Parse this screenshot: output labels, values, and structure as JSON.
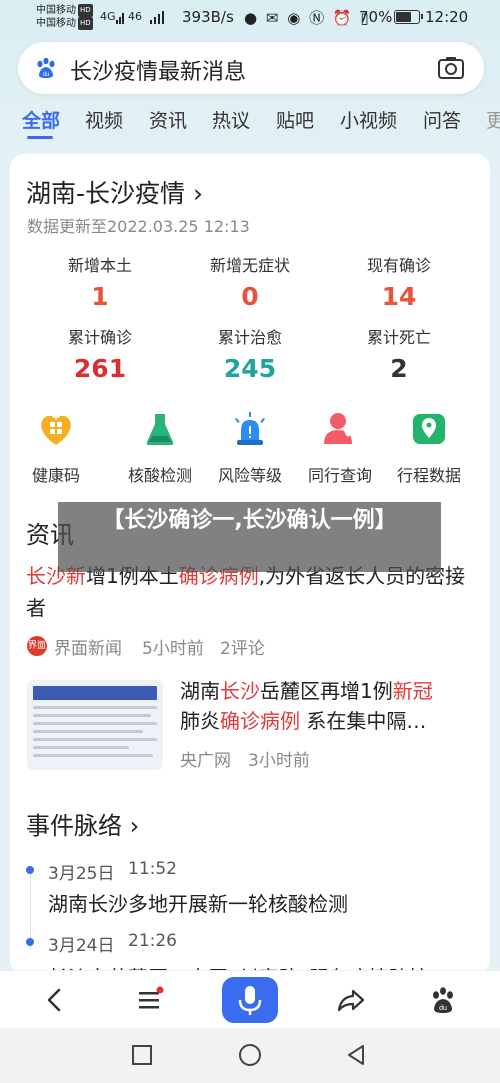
{
  "status_bar": {
    "carrier1": "中国移动",
    "carrier2": "中国移动",
    "hd": "HD",
    "signal1": "4G",
    "signal2": "46",
    "net_speed": "393B/s",
    "battery_pct": "70%",
    "battery_level": 0.7,
    "time": "12:20"
  },
  "search": {
    "query": "长沙疫情最新消息",
    "icon_left": "baidu-paw-icon",
    "icon_right": "camera-icon"
  },
  "tabs": [
    "全部",
    "视频",
    "资讯",
    "热议",
    "贴吧",
    "小视频",
    "问答",
    "更"
  ],
  "card": {
    "title": "湖南-长沙疫情 ›",
    "updated": "数据更新至2022.03.25 12:13",
    "stats": [
      {
        "label": "新增本土",
        "value": "1",
        "color": "#e8533b"
      },
      {
        "label": "新增无症状",
        "value": "0",
        "color": "#e8533b"
      },
      {
        "label": "现有确诊",
        "value": "14",
        "color": "#e8533b"
      },
      {
        "label": "累计确诊",
        "value": "261",
        "color": "#d92f2f"
      },
      {
        "label": "累计治愈",
        "value": "245",
        "color": "#1ea59a"
      },
      {
        "label": "累计死亡",
        "value": "2",
        "color": "#333333"
      }
    ],
    "quick_links": [
      {
        "label": "健康码",
        "icon": "health-code-icon",
        "color": "#f5b020"
      },
      {
        "label": "核酸检测",
        "icon": "flask-icon",
        "color": "#2ab27b"
      },
      {
        "label": "风险等级",
        "icon": "alarm-light-icon",
        "color": "#2d8cf0"
      },
      {
        "label": "同行查询",
        "icon": "people-icon",
        "color": "#f25c6a"
      },
      {
        "label": "行程数据",
        "icon": "location-icon",
        "color": "#24b36b"
      }
    ]
  },
  "news_section": {
    "heading": "资讯",
    "item1": {
      "part1": "长沙新",
      "part2": "增1例本土",
      "part3": "确诊病例",
      "part4": ",为外省返长人员的密接者",
      "source": "界面新闻",
      "time": "5小时前",
      "comments": "2评论",
      "source_logo_text": "界面"
    },
    "item2": {
      "part1": "湖南",
      "part2": "长沙",
      "part3": "岳麓区再增1例",
      "part4": "新冠",
      "part5": "肺炎",
      "part6": "确诊病例",
      "part7": " 系在集中隔…",
      "source": "央广网",
      "time": "3小时前"
    }
  },
  "timeline": {
    "heading": "事件脉络 ›",
    "events": [
      {
        "date": "3月25日",
        "time": "11:52",
        "text": "湖南长沙多地开展新一轮核酸检测"
      },
      {
        "date": "3月24日",
        "time": "21:26",
        "text": "长沙市芙蓉区：志愿“纠察队”服务疫情防控"
      }
    ]
  },
  "overlay_banner": "【长沙确诊一,长沙确认一例】"
}
